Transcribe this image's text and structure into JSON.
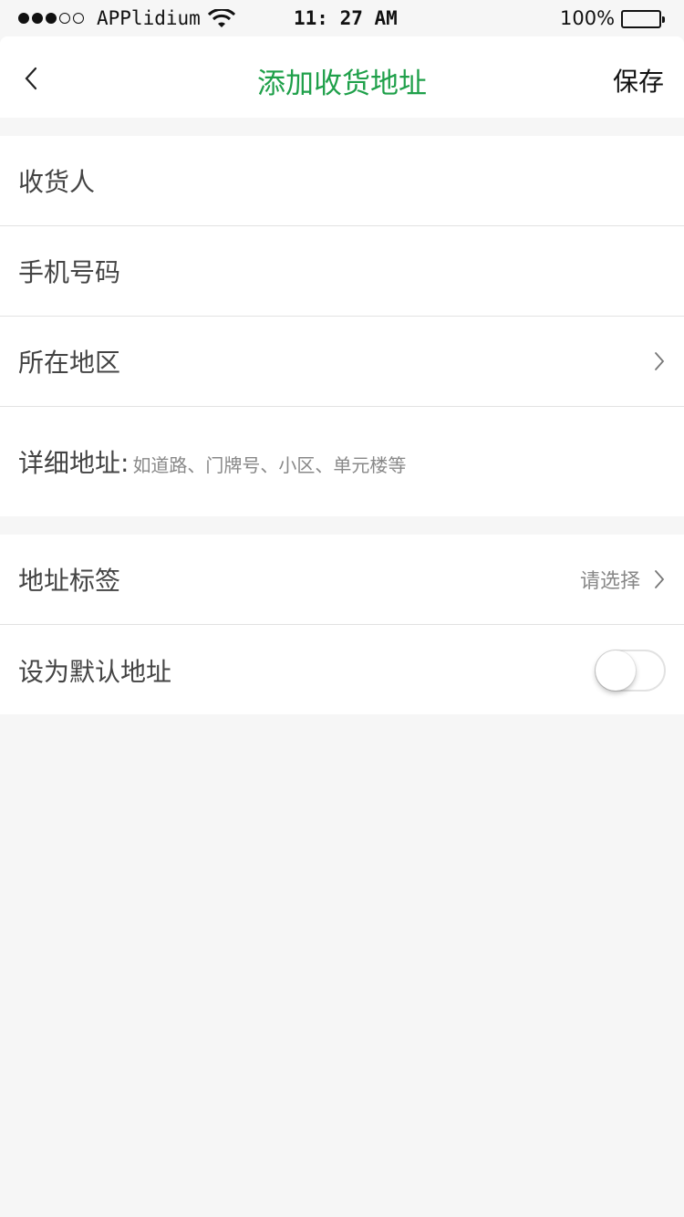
{
  "status_bar": {
    "carrier": "APPlidium",
    "time": "11: 27 AM",
    "battery": "100%"
  },
  "nav": {
    "title": "添加收货地址",
    "save_label": "保存",
    "title_color": "#1fa04a"
  },
  "form": {
    "receiver_label": "收货人",
    "phone_label": "手机号码",
    "region_label": "所在地区",
    "address_label": "详细地址:",
    "address_hint": "如道路、门牌号、小区、单元楼等"
  },
  "options": {
    "tag_label": "地址标签",
    "tag_placeholder": "请选择",
    "default_label": "设为默认地址",
    "default_on": false
  },
  "icons": [
    "back-chevron-icon",
    "chevron-right-icon",
    "wifi-icon",
    "battery-icon",
    "signal-dots-icon"
  ]
}
